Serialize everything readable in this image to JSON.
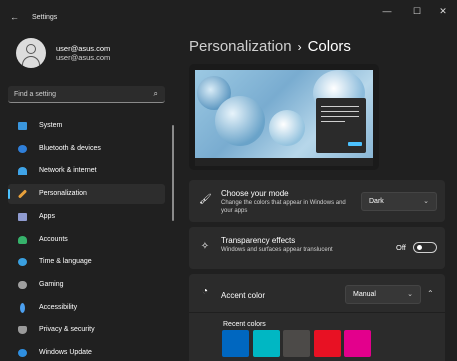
{
  "window": {
    "title": "Settings",
    "back_glyph": "←",
    "minimize_glyph": "—",
    "maximize_glyph": "☐",
    "close_glyph": "✕"
  },
  "user": {
    "name": "user@asus.com",
    "email": "user@asus.com"
  },
  "search": {
    "placeholder": "Find a setting",
    "icon": "search-icon",
    "icon_glyph": "⌕"
  },
  "nav": {
    "accent_color": "#4cc2ff",
    "items": [
      {
        "label": "System",
        "icon": "monitor-icon",
        "color": "#3a96dd",
        "active": false
      },
      {
        "label": "Bluetooth & devices",
        "icon": "bluetooth-icon",
        "color": "#2f7fd9",
        "active": false
      },
      {
        "label": "Network & internet",
        "icon": "wifi-icon",
        "color": "#3fa4e8",
        "active": false
      },
      {
        "label": "Personalization",
        "icon": "brush-icon",
        "color": "#e8a13c",
        "active": true
      },
      {
        "label": "Apps",
        "icon": "apps-icon",
        "color": "#8f9bd0",
        "active": false
      },
      {
        "label": "Accounts",
        "icon": "person-icon",
        "color": "#36b26b",
        "active": false
      },
      {
        "label": "Time & language",
        "icon": "globe-icon",
        "color": "#3aa0e0",
        "active": false
      },
      {
        "label": "Gaming",
        "icon": "gamepad-icon",
        "color": "#a0a0a0",
        "active": false
      },
      {
        "label": "Accessibility",
        "icon": "accessibility-icon",
        "color": "#4ca0f0",
        "active": false
      },
      {
        "label": "Privacy & security",
        "icon": "shield-icon",
        "color": "#9a9a9a",
        "active": false
      },
      {
        "label": "Windows Update",
        "icon": "update-icon",
        "color": "#2f8fe0",
        "active": false
      }
    ]
  },
  "header": {
    "parent": "Personalization",
    "separator": "›",
    "current": "Colors"
  },
  "settings": {
    "mode": {
      "title": "Choose your mode",
      "description": "Change the colors that appear in Windows and your apps",
      "value": "Dark",
      "icon": "paint-brush-icon",
      "icon_glyph": "🖌"
    },
    "transparency": {
      "title": "Transparency effects",
      "description": "Windows and surfaces appear translucent",
      "state_label": "Off",
      "icon": "transparency-icon",
      "icon_glyph": "✧"
    },
    "accent": {
      "title": "Accent color",
      "value": "Manual",
      "icon": "palette-icon",
      "icon_glyph": "◔",
      "expanded": true
    }
  },
  "chevrons": {
    "down": "⌄",
    "up": "⌃"
  },
  "recent_colors": {
    "title": "Recent colors",
    "colors": [
      "#0067c0",
      "#00b7c3",
      "#4c4a48",
      "#e81123",
      "#e3008c"
    ]
  }
}
